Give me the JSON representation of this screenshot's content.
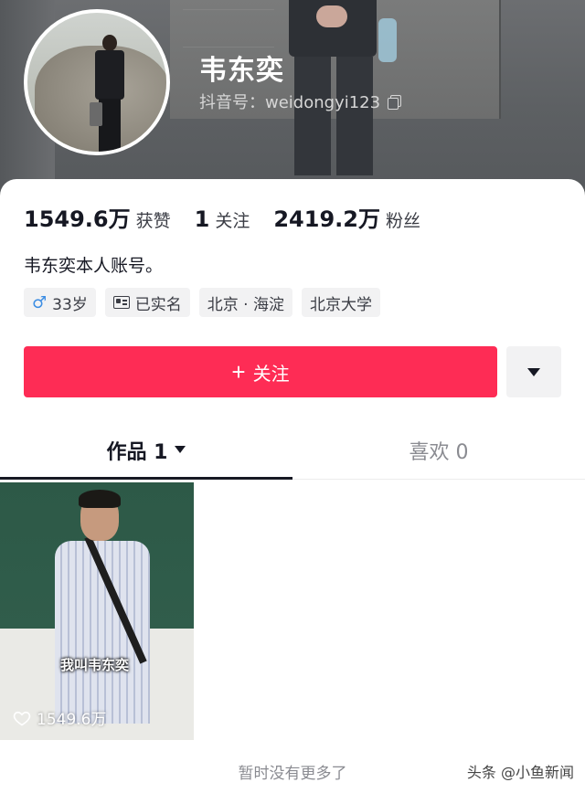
{
  "profile": {
    "name": "韦东奕",
    "handle": "抖音号：weidongyi123",
    "bio": "韦东奕本人账号。"
  },
  "stats": [
    {
      "num": "1549.6万",
      "label": "获赞"
    },
    {
      "num": "1",
      "label": "关注"
    },
    {
      "num": "2419.2万",
      "label": "粉丝"
    }
  ],
  "tags": {
    "age": "33岁",
    "verified": "已实名",
    "location": "北京 · 海淀",
    "school": "北京大学"
  },
  "actions": {
    "follow_label": "关注",
    "follow_plus": "+"
  },
  "tabs": {
    "works": "作品 1",
    "likes": "喜欢 0"
  },
  "video": {
    "caption": "我叫韦东奕",
    "likes": "1549.6万"
  },
  "footer": {
    "no_more": "暂时没有更多了",
    "watermark": "头条 @小鱼新闻"
  },
  "colors": {
    "accent": "#fe2c55",
    "male_icon": "#3c8de3"
  }
}
